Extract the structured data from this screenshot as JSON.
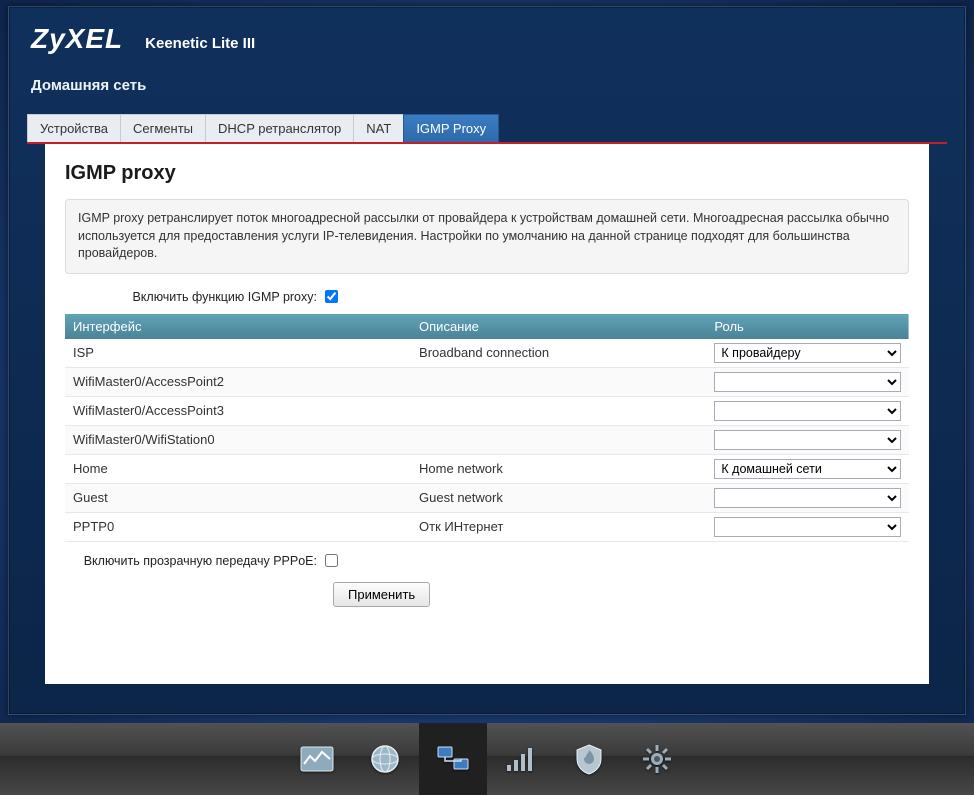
{
  "brand": {
    "logo": "ZyXEL",
    "model": "Keenetic Lite III"
  },
  "breadcrumb": "Домашняя сеть",
  "tabs": [
    {
      "label": "Устройства",
      "active": false
    },
    {
      "label": "Сегменты",
      "active": false
    },
    {
      "label": "DHCP ретранслятор",
      "active": false
    },
    {
      "label": "NAT",
      "active": false
    },
    {
      "label": "IGMP Proxy",
      "active": true
    }
  ],
  "page": {
    "title": "IGMP proxy",
    "info": "IGMP proxy ретранслирует поток многоадресной рассылки от провайдера к устройствам домашней сети. Многоадресная рассылка обычно используется для предоставления услуги IP-телевидения. Настройки по умолчанию на данной странице подходят для большинства провайдеров.",
    "enable_label": "Включить функцию IGMP proxy:",
    "enable_checked": true,
    "columns": {
      "iface": "Интерфейс",
      "desc": "Описание",
      "role": "Роль"
    },
    "role_options": [
      "",
      "К провайдеру",
      "К домашней сети"
    ],
    "rows": [
      {
        "iface": "ISP",
        "desc": "Broadband connection",
        "role": "К провайдеру"
      },
      {
        "iface": "WifiMaster0/AccessPoint2",
        "desc": "",
        "role": ""
      },
      {
        "iface": "WifiMaster0/AccessPoint3",
        "desc": "",
        "role": ""
      },
      {
        "iface": "WifiMaster0/WifiStation0",
        "desc": "",
        "role": ""
      },
      {
        "iface": "Home",
        "desc": "Home network",
        "role": "К домашней сети"
      },
      {
        "iface": "Guest",
        "desc": "Guest network",
        "role": ""
      },
      {
        "iface": "PPTP0",
        "desc": "Отк ИНтернет",
        "role": ""
      }
    ],
    "pppoe_label": "Включить прозрачную передачу PPPoE:",
    "pppoe_checked": false,
    "apply_label": "Применить"
  },
  "dock": [
    {
      "name": "status-icon",
      "active": false
    },
    {
      "name": "globe-icon",
      "active": false
    },
    {
      "name": "network-icon",
      "active": true
    },
    {
      "name": "wifi-icon",
      "active": false
    },
    {
      "name": "firewall-icon",
      "active": false
    },
    {
      "name": "settings-icon",
      "active": false
    }
  ]
}
